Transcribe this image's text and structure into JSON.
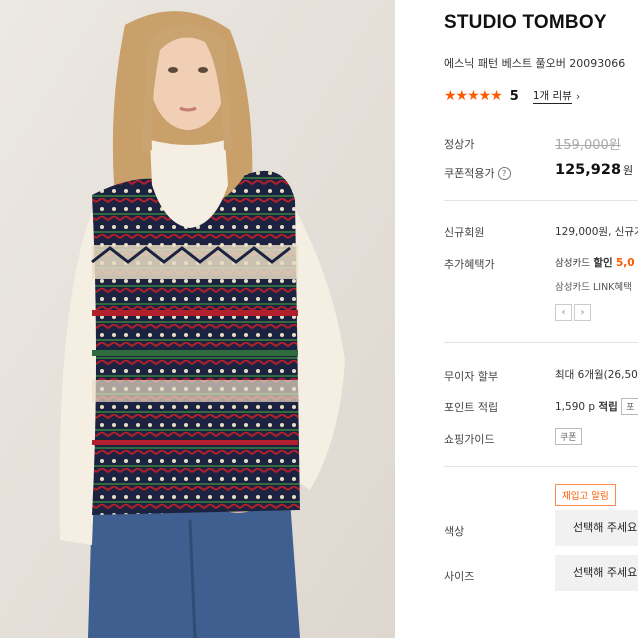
{
  "product": {
    "brand": "STUDIO TOMBOY",
    "name": "에스닉 패턴 베스트 풀오버 20093066",
    "stars": "★★★★★",
    "rating_score": "5",
    "review_link": "1개 리뷰",
    "review_chevron": "›"
  },
  "price": {
    "list_label": "정상가",
    "list_value": "159,000원",
    "coupon_label": "쿠폰적용가",
    "coupon_value": "125,928",
    "coupon_unit": "원",
    "help_icon": "?"
  },
  "benefits": {
    "new_member_label": "신규회원",
    "new_member_value": "129,000원, 신규가",
    "extra_label": "추가혜택가",
    "extra_card": "삼성카드",
    "extra_discount": "할인",
    "extra_amount": "5,0",
    "extra_line2": "삼성카드 LINK혜택",
    "prev_arrow": "‹",
    "next_arrow": "›"
  },
  "payment": {
    "installment_label": "무이자 할부",
    "installment_value": "최대 6개월(26,50",
    "points_label": "포인트 적립",
    "points_value": "1,590 p",
    "points_word": "적립",
    "points_tag": "포",
    "guide_label": "쇼핑가이드",
    "guide_tag": "쿠폰"
  },
  "options": {
    "restock_button": "재입고 알림",
    "color_label": "색상",
    "color_placeholder": "선택해 주세요",
    "size_label": "사이즈",
    "size_placeholder": "선택해 주세요"
  },
  "colors": {
    "accent": "#ff5a00",
    "background": "#ffffff",
    "photo_bg": "#e6e2dc",
    "select_bg": "#f1f1f1"
  },
  "icons": [
    "star-icon",
    "chevron-right-icon",
    "help-icon",
    "arrow-left-icon",
    "arrow-right-icon"
  ]
}
